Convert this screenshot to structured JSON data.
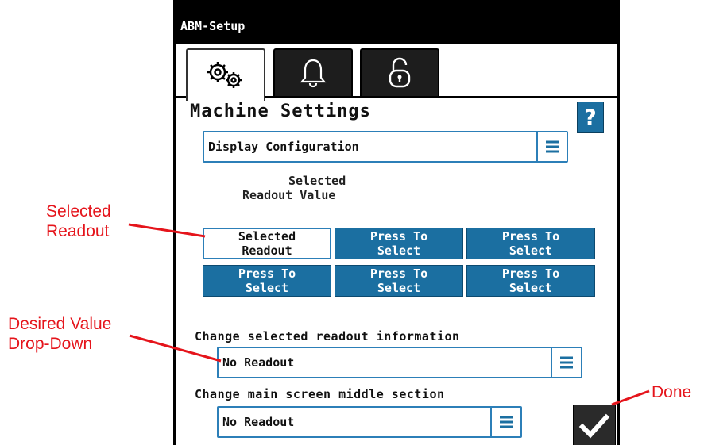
{
  "window": {
    "title": "ABM-Setup"
  },
  "tabs": [
    {
      "name": "settings",
      "icon": "gears-icon"
    },
    {
      "name": "alarms",
      "icon": "bell-icon"
    },
    {
      "name": "lock",
      "icon": "lock-icon"
    }
  ],
  "page": {
    "heading": "Machine Settings",
    "help_label": "?",
    "config_dropdown": {
      "value": "Display Configuration",
      "icon": "menu-lines-icon"
    },
    "selected_title_line1": "Selected",
    "selected_title_line2": "Readout Value"
  },
  "readout_buttons": [
    {
      "line1": "Selected",
      "line2": "Readout",
      "selected": true
    },
    {
      "line1": "Press To",
      "line2": "Select"
    },
    {
      "line1": "Press To",
      "line2": "Select"
    },
    {
      "line1": "Press To",
      "line2": "Select"
    },
    {
      "line1": "Press To",
      "line2": "Select"
    },
    {
      "line1": "Press To",
      "line2": "Select"
    }
  ],
  "change_readout": {
    "label": "Change selected readout information",
    "value": "No Readout"
  },
  "change_middle": {
    "label": "Change main screen middle section",
    "value": "No Readout"
  },
  "done_icon": "checkmark-icon",
  "callouts": {
    "selected_readout_line1": "Selected",
    "selected_readout_line2": "Readout",
    "desired_value_line1": "Desired Value",
    "desired_value_line2": "Drop-Down",
    "done": "Done"
  },
  "colors": {
    "accent_blue": "#1b6fa1",
    "callout_red": "#e5141b",
    "titlebar": "#000000"
  }
}
